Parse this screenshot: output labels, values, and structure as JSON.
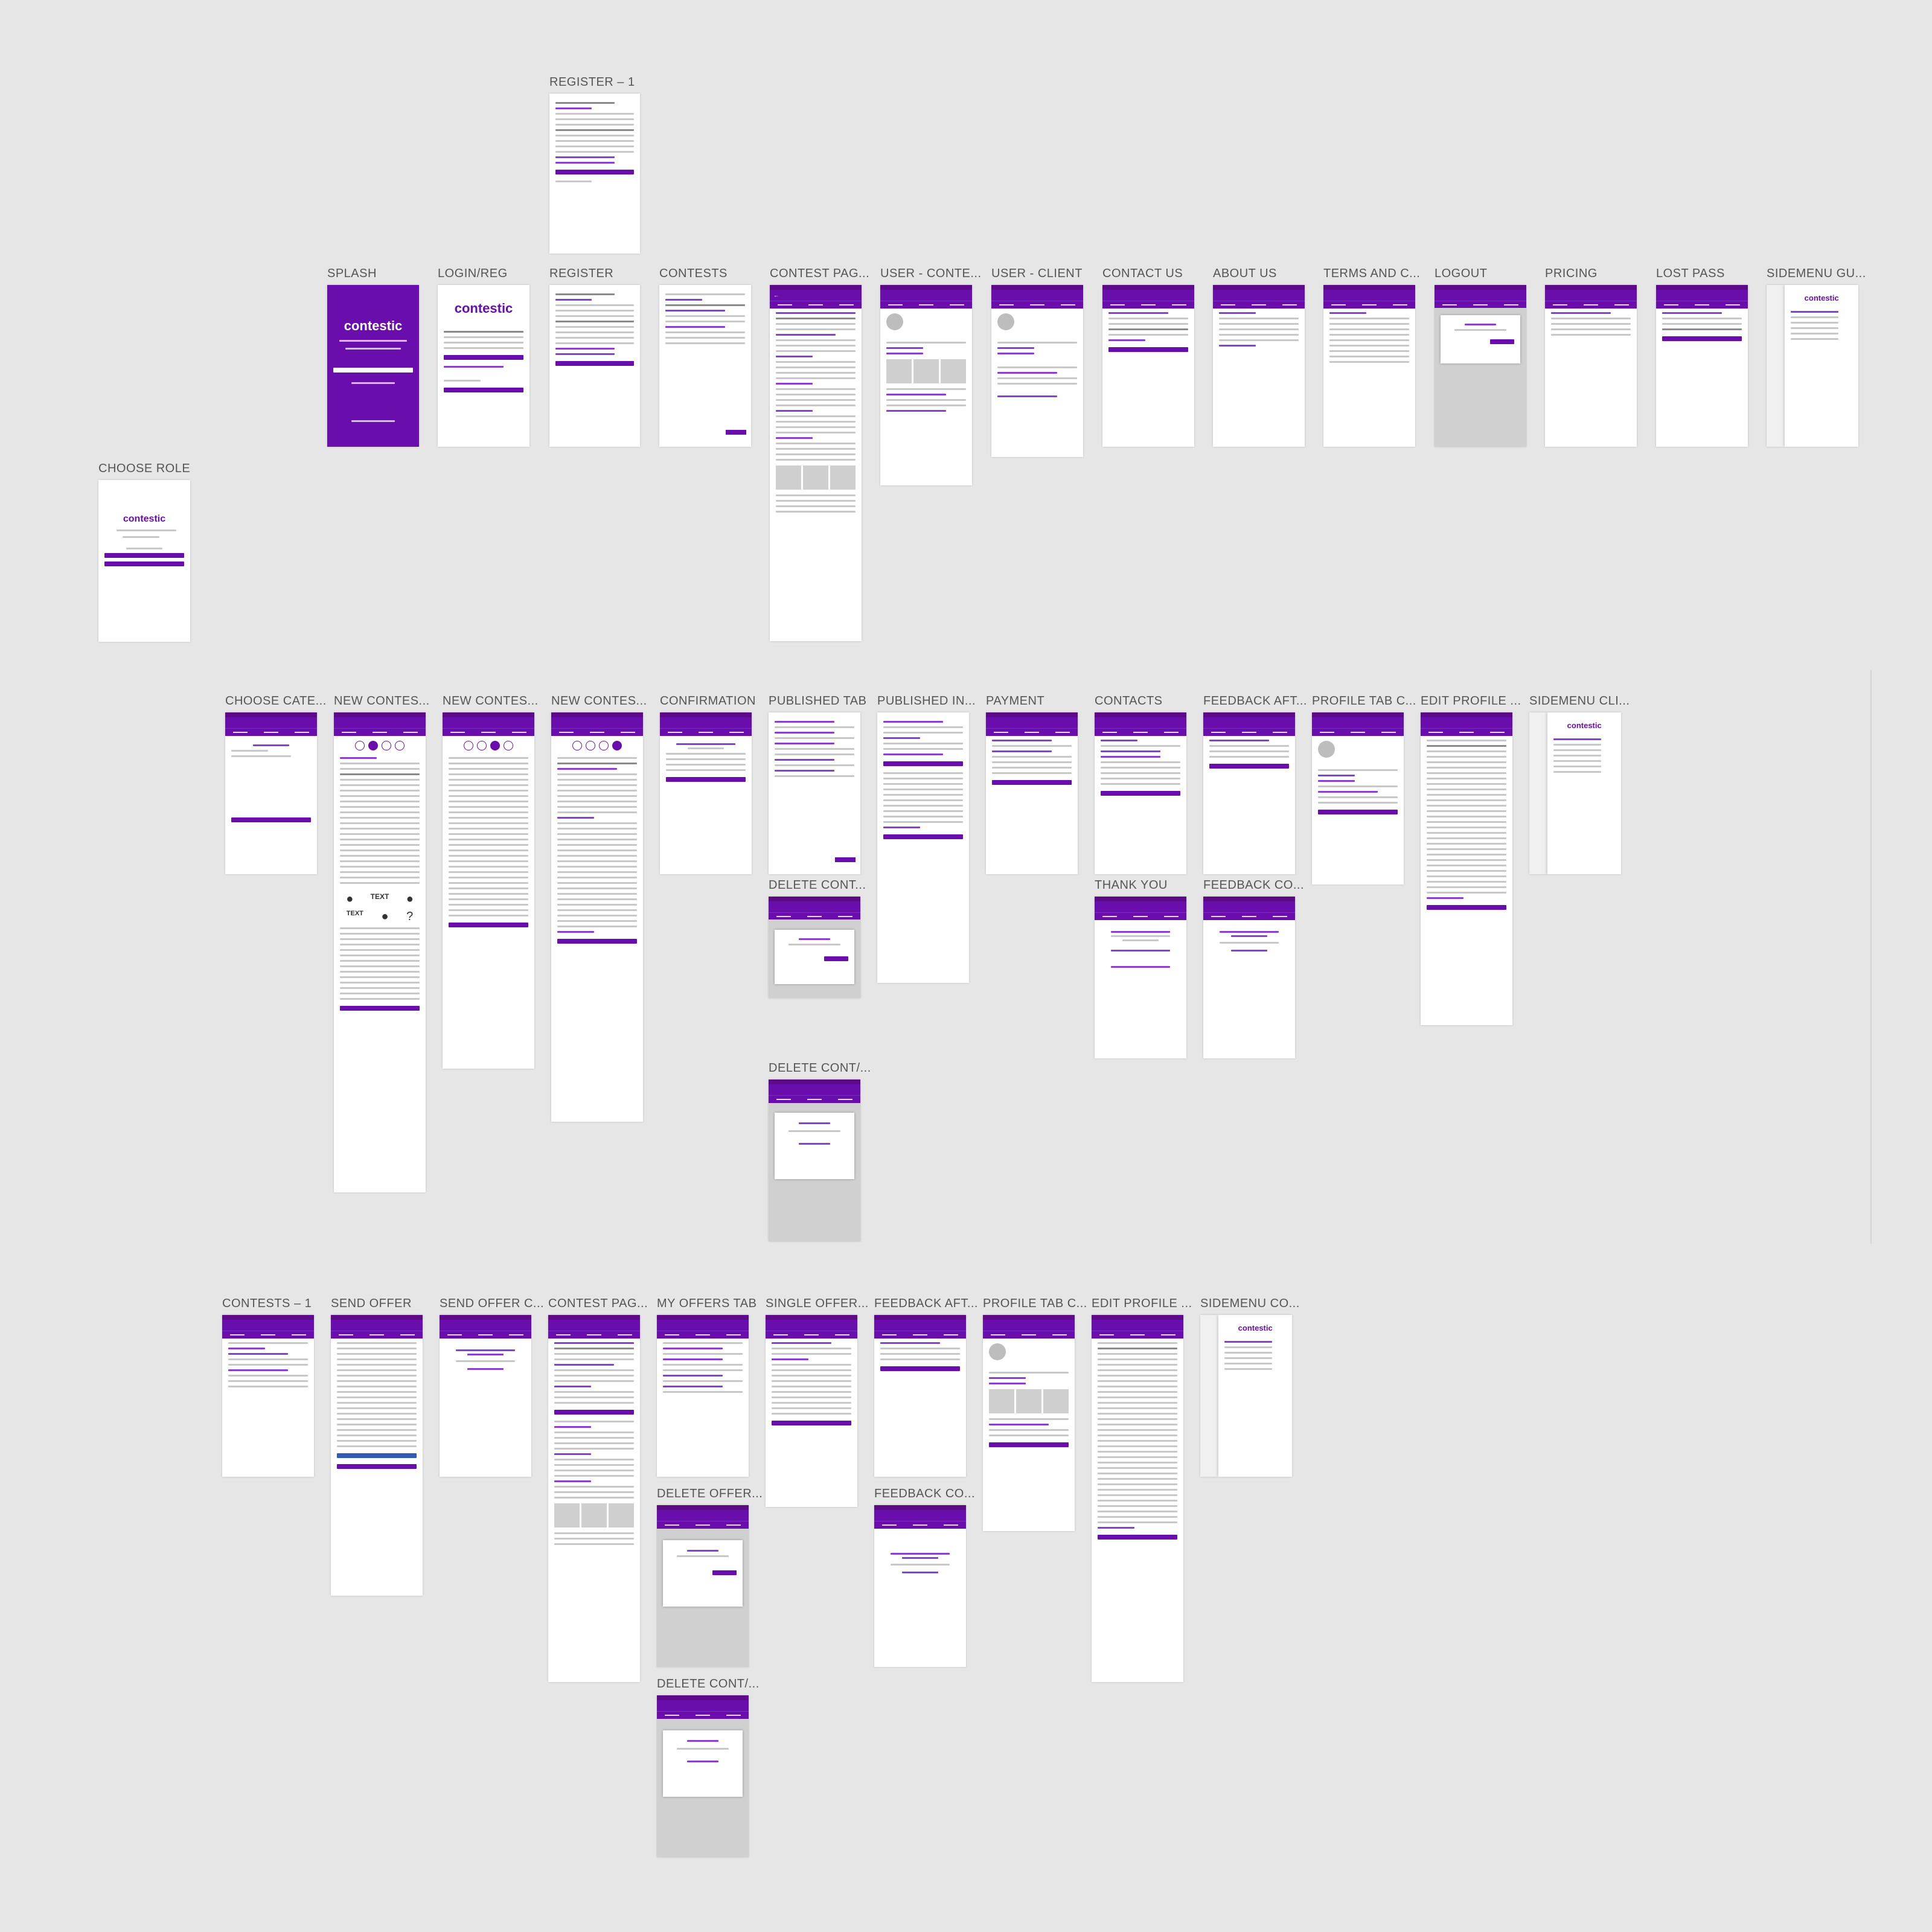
{
  "brand": {
    "name": "contestic",
    "accent": "#6a0dad",
    "canvas_bg": "#e6e6e6"
  },
  "labels": {
    "register_1": "REGISTER – 1",
    "splash": "SPLASH",
    "login_reg": "LOGIN/REG",
    "register": "REGISTER",
    "contests": "CONTESTS",
    "contest_page": "CONTEST PAG...",
    "user_contest": "USER - CONTE...",
    "user_client": "USER - CLIENT",
    "contact_us": "CONTACT US",
    "about_us": "ABOUT US",
    "terms": "TERMS AND C...",
    "logout": "LOGOUT",
    "pricing": "PRICING",
    "lost_pass": "LOST PASS",
    "sidemenu_gu": "SIDEMENU GU...",
    "choose_role": "CHOOSE ROLE",
    "choose_cate": "CHOOSE CATE...",
    "new_contest_1": "NEW CONTES...",
    "new_contest_2": "NEW CONTES...",
    "new_contest_3": "NEW CONTES...",
    "confirmation": "CONFIRMATION",
    "published_tab": "PUBLISHED TAB",
    "published_in": "PUBLISHED IN...",
    "payment": "PAYMENT",
    "contacts": "CONTACTS",
    "feedback_aft_1": "FEEDBACK AFT...",
    "profile_tab_c_1": "PROFILE TAB C...",
    "edit_profile_1": "EDIT PROFILE ...",
    "sidemenu_cli": "SIDEMENU CLI...",
    "delete_cont_1": "DELETE CONT...",
    "thank_you": "THANK YOU",
    "feedback_co_1": "FEEDBACK CO...",
    "delete_cont_2": "DELETE CONT/...",
    "contests_1": "CONTESTS – 1",
    "send_offer": "SEND OFFER",
    "send_offer_c": "SEND OFFER C...",
    "contest_page_2": "CONTEST PAG...",
    "my_offers_tab": "MY OFFERS TAB",
    "single_offer": "SINGLE OFFER...",
    "feedback_aft_2": "FEEDBACK AFT...",
    "profile_tab_c_2": "PROFILE TAB C...",
    "edit_profile_2": "EDIT PROFILE ...",
    "sidemenu_co": "SIDEMENU CO...",
    "delete_offer": "DELETE OFFER...",
    "feedback_co_2": "FEEDBACK CO...",
    "delete_cont_3": "DELETE CONT/..."
  },
  "glyphs": {
    "text_logo": "TEXT",
    "question": "?"
  }
}
